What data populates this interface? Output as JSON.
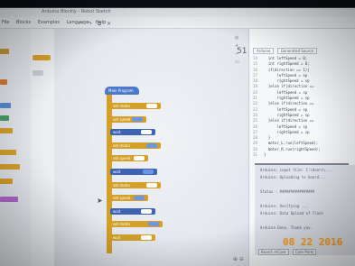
{
  "window": {
    "title": "Arduino Blockly - Robot Sketch",
    "menus": [
      "File",
      "Blocks",
      "Examples",
      "Language",
      "Help"
    ],
    "toolbar_icons": [
      "undo-icon",
      "redo-icon",
      "copy-icon",
      "delete-icon"
    ]
  },
  "sidebar": {
    "categories": [
      {
        "color": "#c89a3a"
      },
      {
        "color": "#e07c3a"
      },
      {
        "color": "#5a8fd6"
      },
      {
        "color": "#4aa06a"
      },
      {
        "color": "#d9a32c"
      },
      {
        "color": "#d9a32c"
      },
      {
        "color": "#d9a32c"
      },
      {
        "color": "#b36ad1"
      }
    ]
  },
  "workspace": {
    "hat_label": "Main Program",
    "blocks": [
      {
        "label": "set motor",
        "color": "#d3a12a"
      },
      {
        "label": "set speed",
        "color": "#d3a12a"
      },
      {
        "label": "wait",
        "color": "#d3a12a"
      },
      {
        "label": "set motor",
        "color": "#d3a12a"
      },
      {
        "label": "set speed",
        "color": "#d3a12a"
      },
      {
        "label": "wait",
        "color": "#d3a12a"
      },
      {
        "label": "set motor",
        "color": "#d3a12a"
      },
      {
        "label": "set speed",
        "color": "#d3a12a"
      },
      {
        "label": "wait",
        "color": "#d3a12a"
      },
      {
        "label": "set motor",
        "color": "#d3a12a"
      },
      {
        "label": "wait",
        "color": "#d3a12a"
      }
    ],
    "side_icons": [
      "target-icon",
      "plus-icon",
      "minus-icon",
      "trash-icon"
    ],
    "zoom_icons": "+ - "
  },
  "code_panel": {
    "tabs": [
      "Arduino",
      "Generated Source"
    ],
    "line_numbers": [
      "14",
      "15",
      "16",
      "17",
      "18",
      "19",
      "20",
      "21",
      "22",
      "23",
      "24",
      "25",
      "26",
      "27",
      "28",
      "29",
      "30",
      "31",
      "32",
      "33",
      "34",
      "35",
      "36",
      "37"
    ],
    "lines": [
      "  int leftSpeed = 0;",
      "  int rightSpeed = 0;",
      "  if(direction == 1){",
      "      leftSpeed = sp",
      "      rightSpeed = sp",
      "  }else if(direction ==",
      "      leftSpeed = sp",
      "      rightSpeed = sp",
      "  }else if(direction ==",
      "      leftSpeed = sp",
      "      rightSpeed = sp",
      "  }else if(direction ==",
      "      leftSpeed = sp",
      "      rightSpeed = sp",
      "  }",
      "  motor_L.run(leftSpeed);",
      "  motor_R.run(rightSpeed);",
      "}"
    ]
  },
  "console": {
    "lines": [
      "Arduino: input file: C:\\Users\\...",
      "Arduino: Uploading to board...",
      "",
      "Status : ################",
      "",
      "Arduino: Verifying ...",
      "Arduino: Data Upload of flash",
      "",
      "Arduino Done. Thank you."
    ],
    "buttons": [
      "Board: mCore",
      "Com Ports"
    ]
  },
  "photo_timestamp": "08 22 2016",
  "colors": {
    "block_yellow": "#d3a12a",
    "block_blue": "#4e78c9",
    "value_blue": "#6d96e0",
    "stamp_orange": "#f0a23a"
  }
}
